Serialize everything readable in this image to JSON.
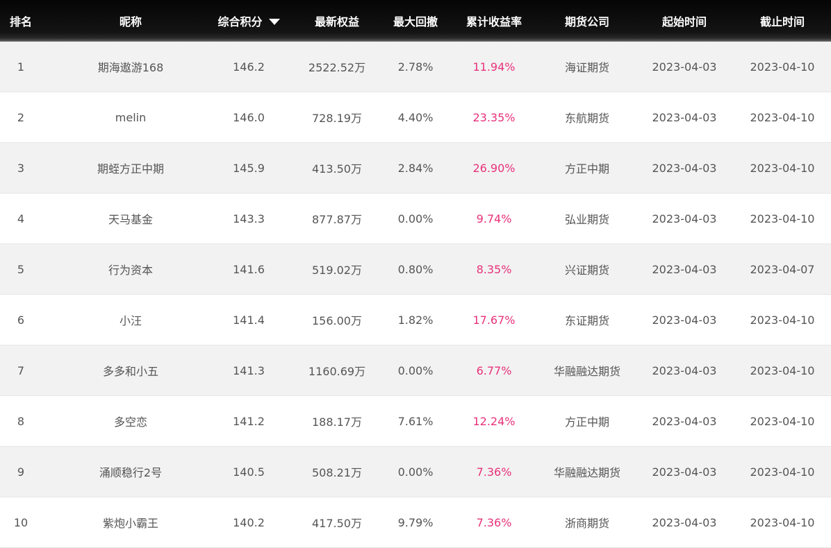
{
  "header": {
    "rank": "排名",
    "nickname": "昵称",
    "score": "综合积分",
    "equity": "最新权益",
    "max_drawdown": "最大回撤",
    "cumulative_return": "累计收益率",
    "company": "期货公司",
    "start_time": "起始时间",
    "end_time": "截止时间",
    "sort_icon": "caret-down-icon"
  },
  "colors": {
    "header_bg": "#141414",
    "header_text": "#ffffff",
    "row_alt_bg": "#f2f2f2",
    "text": "#555555",
    "return_accent": "#e8317a"
  },
  "rows": [
    {
      "rank": "1",
      "nickname": "期海遨游168",
      "score": "146.2",
      "equity": "2522.52万",
      "max_drawdown": "2.78%",
      "cumulative_return": "11.94%",
      "company": "海证期货",
      "start_time": "2023-04-03",
      "end_time": "2023-04-10"
    },
    {
      "rank": "2",
      "nickname": "melin",
      "score": "146.0",
      "equity": "728.19万",
      "max_drawdown": "4.40%",
      "cumulative_return": "23.35%",
      "company": "东航期货",
      "start_time": "2023-04-03",
      "end_time": "2023-04-10"
    },
    {
      "rank": "3",
      "nickname": "期蛭方正中期",
      "score": "145.9",
      "equity": "413.50万",
      "max_drawdown": "2.84%",
      "cumulative_return": "26.90%",
      "company": "方正中期",
      "start_time": "2023-04-03",
      "end_time": "2023-04-10"
    },
    {
      "rank": "4",
      "nickname": "天马基金",
      "score": "143.3",
      "equity": "877.87万",
      "max_drawdown": "0.00%",
      "cumulative_return": "9.74%",
      "company": "弘业期货",
      "start_time": "2023-04-03",
      "end_time": "2023-04-10"
    },
    {
      "rank": "5",
      "nickname": "行为资本",
      "score": "141.6",
      "equity": "519.02万",
      "max_drawdown": "0.80%",
      "cumulative_return": "8.35%",
      "company": "兴证期货",
      "start_time": "2023-04-03",
      "end_time": "2023-04-07"
    },
    {
      "rank": "6",
      "nickname": "小汪",
      "score": "141.4",
      "equity": "156.00万",
      "max_drawdown": "1.82%",
      "cumulative_return": "17.67%",
      "company": "东证期货",
      "start_time": "2023-04-03",
      "end_time": "2023-04-10"
    },
    {
      "rank": "7",
      "nickname": "多多和小五",
      "score": "141.3",
      "equity": "1160.69万",
      "max_drawdown": "0.00%",
      "cumulative_return": "6.77%",
      "company": "华融融达期货",
      "start_time": "2023-04-03",
      "end_time": "2023-04-10"
    },
    {
      "rank": "8",
      "nickname": "多空恋",
      "score": "141.2",
      "equity": "188.17万",
      "max_drawdown": "7.61%",
      "cumulative_return": "12.24%",
      "company": "方正中期",
      "start_time": "2023-04-03",
      "end_time": "2023-04-10"
    },
    {
      "rank": "9",
      "nickname": "涌顺稳行2号",
      "score": "140.5",
      "equity": "508.21万",
      "max_drawdown": "0.00%",
      "cumulative_return": "7.36%",
      "company": "华融融达期货",
      "start_time": "2023-04-03",
      "end_time": "2023-04-10"
    },
    {
      "rank": "10",
      "nickname": "紫炮小霸王",
      "score": "140.2",
      "equity": "417.50万",
      "max_drawdown": "9.79%",
      "cumulative_return": "7.36%",
      "company": "浙商期货",
      "start_time": "2023-04-03",
      "end_time": "2023-04-10"
    }
  ]
}
